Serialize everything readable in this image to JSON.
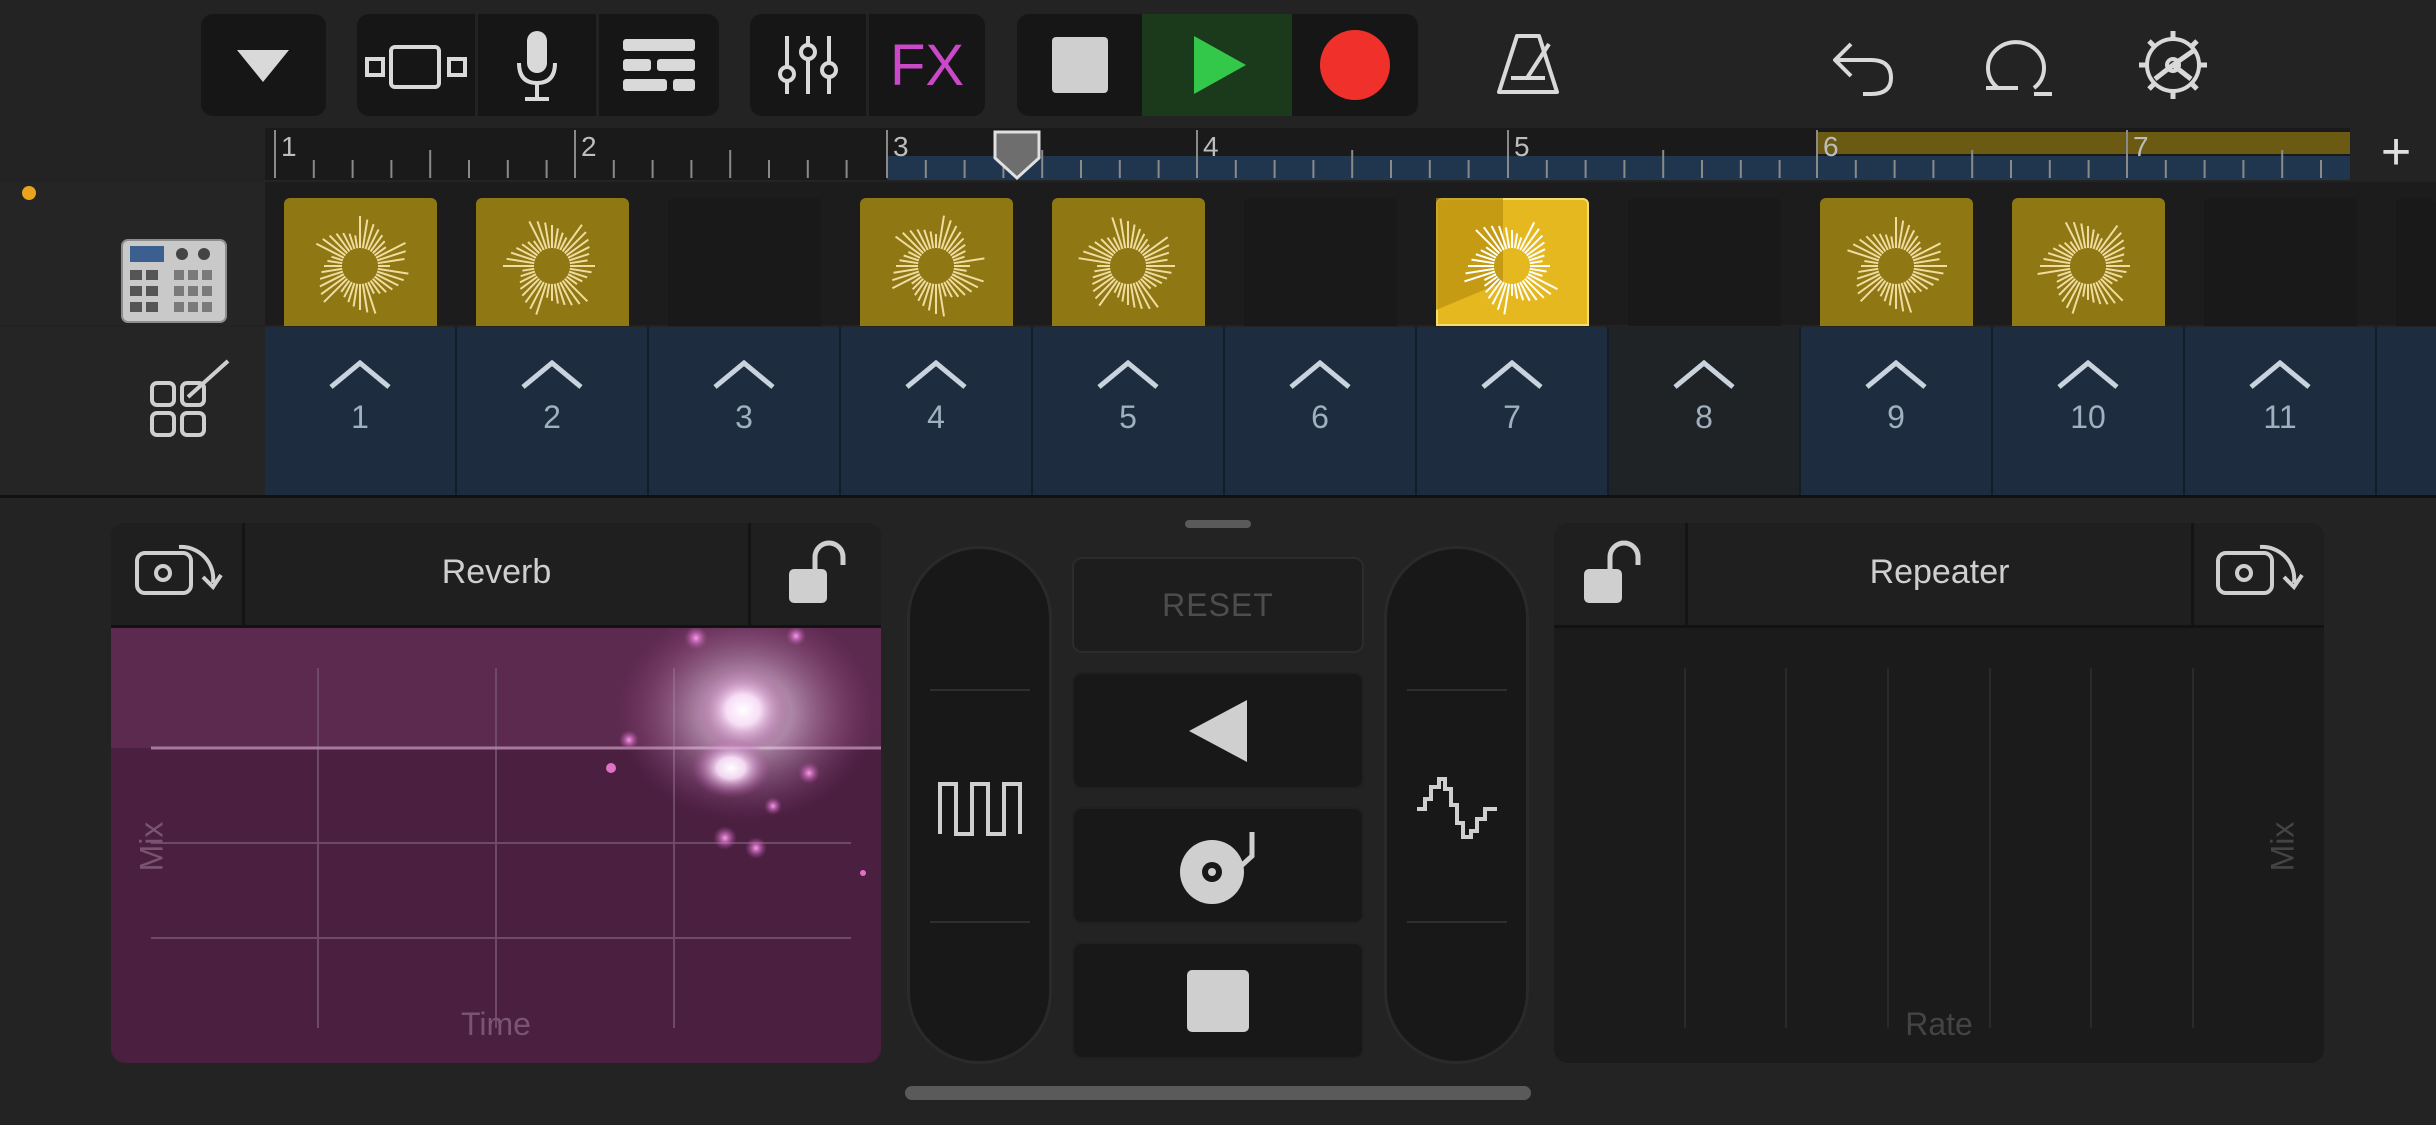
{
  "ruler": {
    "bars": [
      "1",
      "2",
      "3",
      "4",
      "5",
      "6",
      "7"
    ]
  },
  "triggers": [
    "1",
    "2",
    "3",
    "4",
    "5",
    "6",
    "7",
    "8",
    "9",
    "10",
    "11"
  ],
  "fx_left": {
    "title": "Reverb",
    "x_label": "Time",
    "y_label": "Mix",
    "accent": "#4a1f3f"
  },
  "fx_right": {
    "title": "Repeater",
    "x_label": "Rate",
    "y_label": "Mix"
  },
  "center": {
    "reset_label": "RESET"
  },
  "toolbar": {
    "fx_label": "FX"
  },
  "colors": {
    "play": "#34c84a",
    "record": "#f0312b",
    "fx": "#c949c9",
    "cell": "#8f7713",
    "cell_active": "#e6b81f"
  }
}
